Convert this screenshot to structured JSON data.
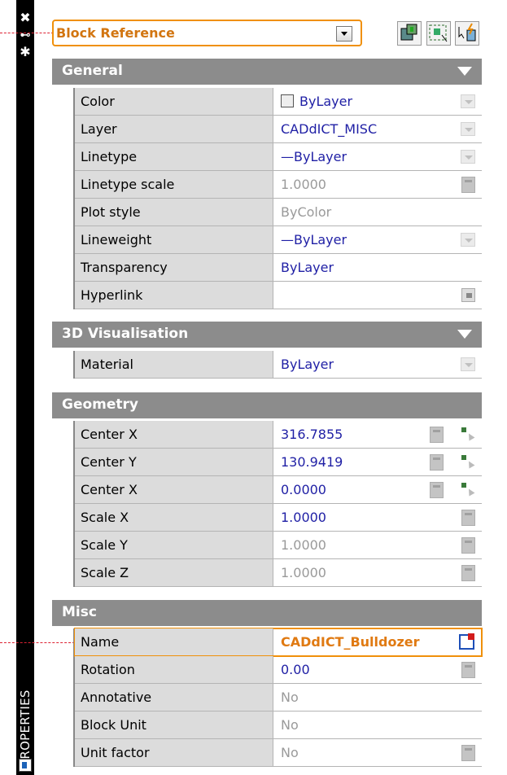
{
  "panel": {
    "vertical_label": "PROPERTIES",
    "selector_value": "Block Reference"
  },
  "sections": [
    {
      "title": "General",
      "rows": [
        {
          "name": "Color",
          "value": "ByLayer",
          "style": "link",
          "control": "dropdown",
          "swatch": true
        },
        {
          "name": "Layer",
          "value": "CADdICT_MISC",
          "style": "link",
          "control": "dropdown"
        },
        {
          "name": "Linetype",
          "value": "—ByLayer",
          "style": "link",
          "control": "dropdown"
        },
        {
          "name": "Linetype scale",
          "value": "1.0000",
          "style": "dim",
          "control": "calc"
        },
        {
          "name": "Plot style",
          "value": "ByColor",
          "style": "dim",
          "control": "none"
        },
        {
          "name": "Lineweight",
          "value": "—ByLayer",
          "style": "link",
          "control": "dropdown"
        },
        {
          "name": "Transparency",
          "value": "ByLayer",
          "style": "link",
          "control": "none"
        },
        {
          "name": "Hyperlink",
          "value": "",
          "style": "link",
          "control": "hyperlink"
        }
      ]
    },
    {
      "title": "3D Visualisation",
      "rows": [
        {
          "name": "Material",
          "value": "ByLayer",
          "style": "link",
          "control": "dropdown"
        }
      ]
    },
    {
      "title": "Geometry",
      "rows": [
        {
          "name": "Center X",
          "value": "316.7855",
          "style": "link",
          "control": "calc-pick"
        },
        {
          "name": "Center Y",
          "value": "130.9419",
          "style": "link",
          "control": "calc-pick"
        },
        {
          "name": "Center X",
          "value": "0.0000",
          "style": "link",
          "control": "calc-pick"
        },
        {
          "name": "Scale X",
          "value": "1.0000",
          "style": "link",
          "control": "calc"
        },
        {
          "name": "Scale Y",
          "value": "1.0000",
          "style": "dim",
          "control": "calc"
        },
        {
          "name": "Scale Z",
          "value": "1.0000",
          "style": "dim",
          "control": "calc"
        }
      ]
    },
    {
      "title": "Misc",
      "rows": [
        {
          "name": "Name",
          "value": "CADdICT_Bulldozer",
          "style": "orange",
          "control": "block-edit"
        },
        {
          "name": "Rotation",
          "value": "0.00",
          "style": "link",
          "control": "calc"
        },
        {
          "name": "Annotative",
          "value": "No",
          "style": "dim",
          "control": "none"
        },
        {
          "name": "Block Unit",
          "value": "No",
          "style": "dim",
          "control": "none"
        },
        {
          "name": "Unit factor",
          "value": "No",
          "style": "dim",
          "control": "calc"
        }
      ]
    }
  ]
}
